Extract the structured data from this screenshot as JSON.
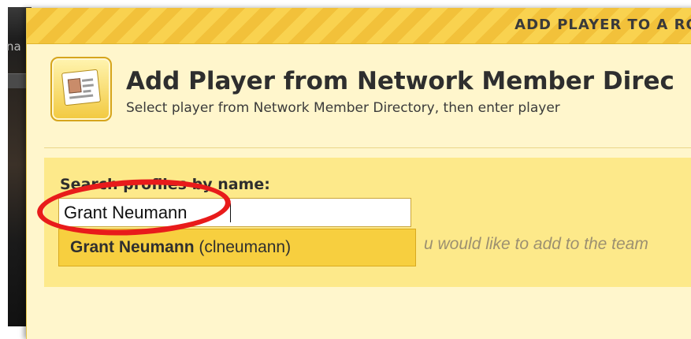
{
  "backdrop": {
    "text": "na"
  },
  "modal": {
    "header_title": "ADD PLAYER TO A ROST",
    "title": "Add Player from Network Member Direc",
    "subtitle": "Select player from Network Member Directory, then enter player",
    "icon": "address-card-icon",
    "search": {
      "label": "Search profiles by name:",
      "value": "Grant Neumann",
      "placeholder": ""
    },
    "suggestion": {
      "name": "Grant Neumann",
      "username": "(clneumann)"
    },
    "hint": "u would like to add to the team"
  },
  "colors": {
    "panel": "#fde98a",
    "modal_bg": "#fff6cc",
    "header_stripe": "#f9d24f",
    "suggestion_bg": "#f7cf3f",
    "highlight_ring": "#e81b1b"
  }
}
